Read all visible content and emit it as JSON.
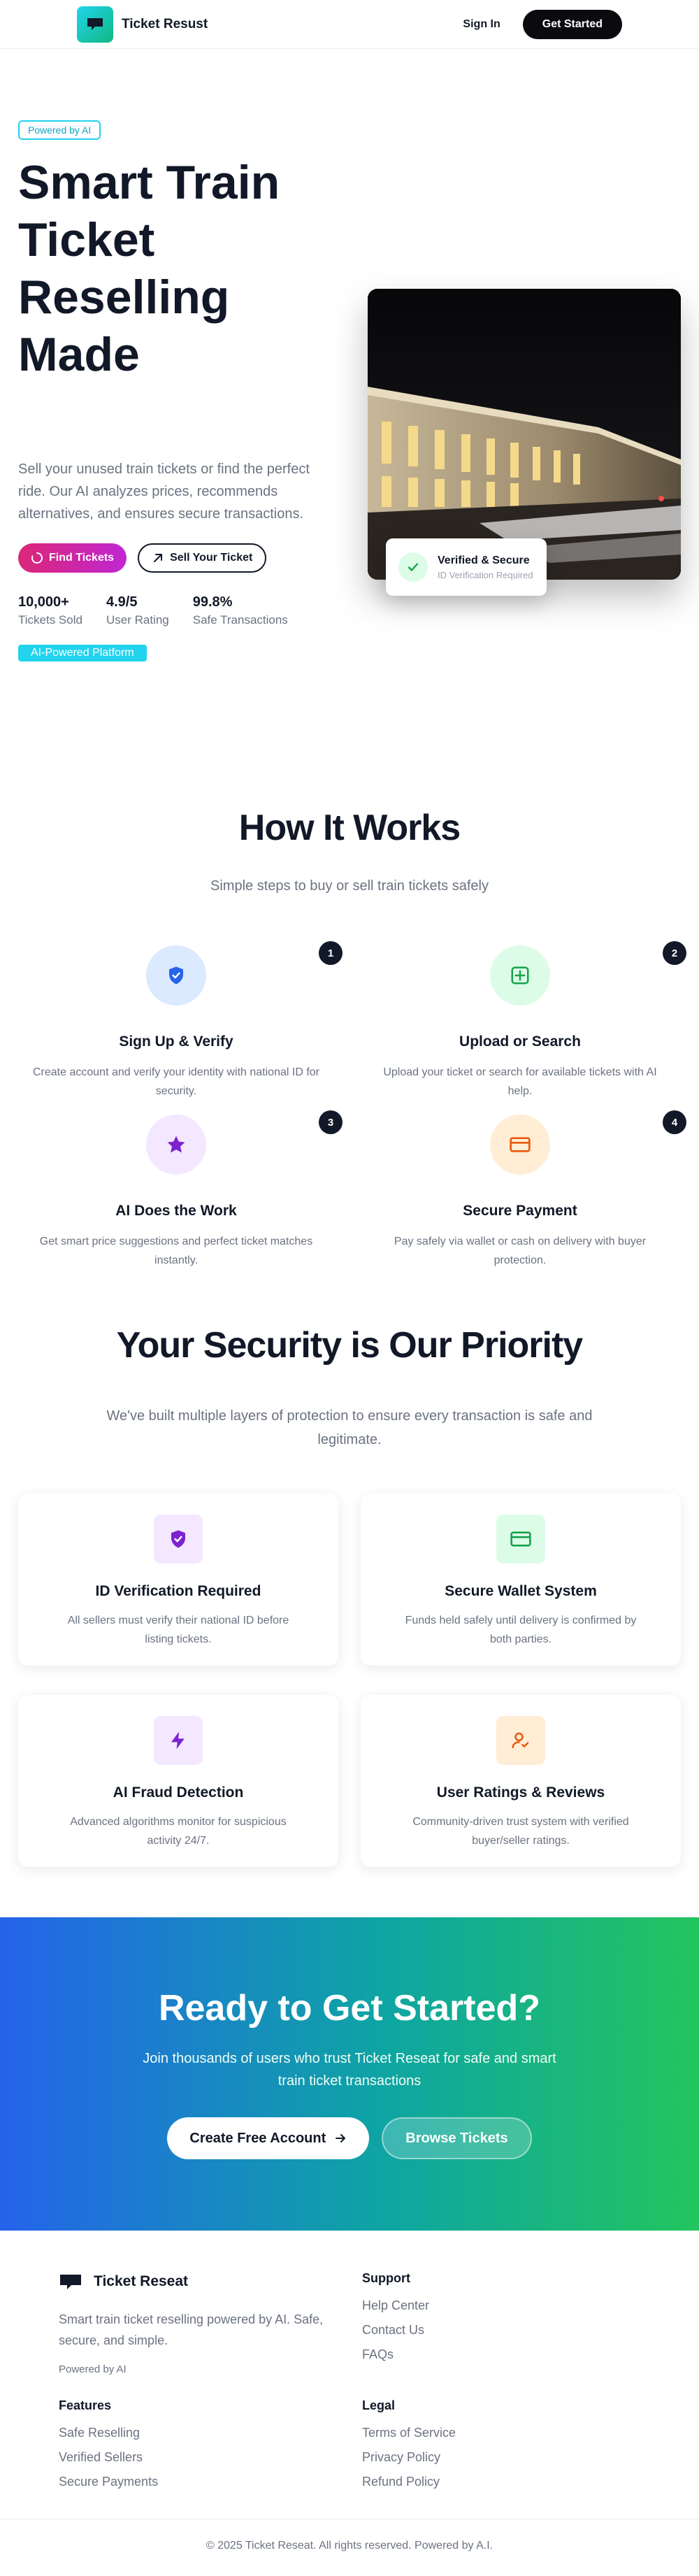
{
  "nav": {
    "brand": "Ticket Resust",
    "signin": "Sign In",
    "cta": "Get Started"
  },
  "hero": {
    "badge": "Powered by AI",
    "title": "Smart Train Ticket Reselling Made",
    "description": "Sell your unused train tickets or find the perfect ride. Our AI analyzes prices, recommends alternatives, and ensures secure transactions.",
    "find_btn": "Find Tickets",
    "sell_btn": "Sell Your Ticket",
    "stats": [
      {
        "value": "10,000+",
        "label": "Tickets Sold"
      },
      {
        "value": "4.9/5",
        "label": "User Rating"
      },
      {
        "value": "99.8%",
        "label": "Safe Transactions"
      }
    ],
    "platform_badge": "AI-Powered Platform",
    "verified_title": "Verified & Secure",
    "verified_sub": "ID Verification Required"
  },
  "how": {
    "title": "How It Works",
    "subtitle": "Simple steps to buy or sell train tickets safely",
    "steps": [
      {
        "num": "1",
        "title": "Sign Up & Verify",
        "desc": "Create account and verify your identity with national ID for security.",
        "icon": "shield-check-icon"
      },
      {
        "num": "2",
        "title": "Upload or Search",
        "desc": "Upload your ticket or search for available tickets with AI help.",
        "icon": "plus-square-icon"
      },
      {
        "num": "3",
        "title": "AI Does the Work",
        "desc": "Get smart price suggestions and perfect ticket matches instantly.",
        "icon": "star-icon"
      },
      {
        "num": "4",
        "title": "Secure Payment",
        "desc": "Pay safely via wallet or cash on delivery with buyer protection.",
        "icon": "credit-card-icon"
      }
    ]
  },
  "security": {
    "title": "Your Security is Our Priority",
    "subtitle": "We've built multiple layers of protection to ensure every transaction is safe and legitimate.",
    "cards": [
      {
        "title": "ID Verification Required",
        "desc": "All sellers must verify their national ID before listing tickets.",
        "icon": "shield-check-icon"
      },
      {
        "title": "Secure Wallet System",
        "desc": "Funds held safely until delivery is confirmed by both parties.",
        "icon": "wallet-icon"
      },
      {
        "title": "AI Fraud Detection",
        "desc": "Advanced algorithms monitor for suspicious activity 24/7.",
        "icon": "lightning-icon"
      },
      {
        "title": "User Ratings & Reviews",
        "desc": "Community-driven trust system with verified buyer/seller ratings.",
        "icon": "user-check-icon"
      }
    ]
  },
  "cta": {
    "title": "Ready to Get Started?",
    "subtitle": "Join thousands of users who trust Ticket Reseat for safe and smart train ticket transactions",
    "primary": "Create Free Account",
    "secondary": "Browse Tickets"
  },
  "footer": {
    "brand": "Ticket Reseat",
    "desc": "Smart train ticket reselling powered by AI. Safe, secure, and simple.",
    "powered": "Powered by AI",
    "support_title": "Support",
    "support_links": [
      "Help Center",
      "Contact Us",
      "FAQs"
    ],
    "features_title": "Features",
    "features_links": [
      "Safe Reselling",
      "Verified Sellers",
      "Secure Payments"
    ],
    "legal_title": "Legal",
    "legal_links": [
      "Terms of Service",
      "Privacy Policy",
      "Refund Policy"
    ],
    "copyright": "© 2025 Ticket Reseat. All rights reserved. Powered by A.I."
  },
  "colors": {
    "accent_cyan": "#22d3ee",
    "accent_pink": "#db2777",
    "dark": "#0b0b0f",
    "cta_blue": "#2563eb",
    "cta_green": "#22c55e"
  }
}
